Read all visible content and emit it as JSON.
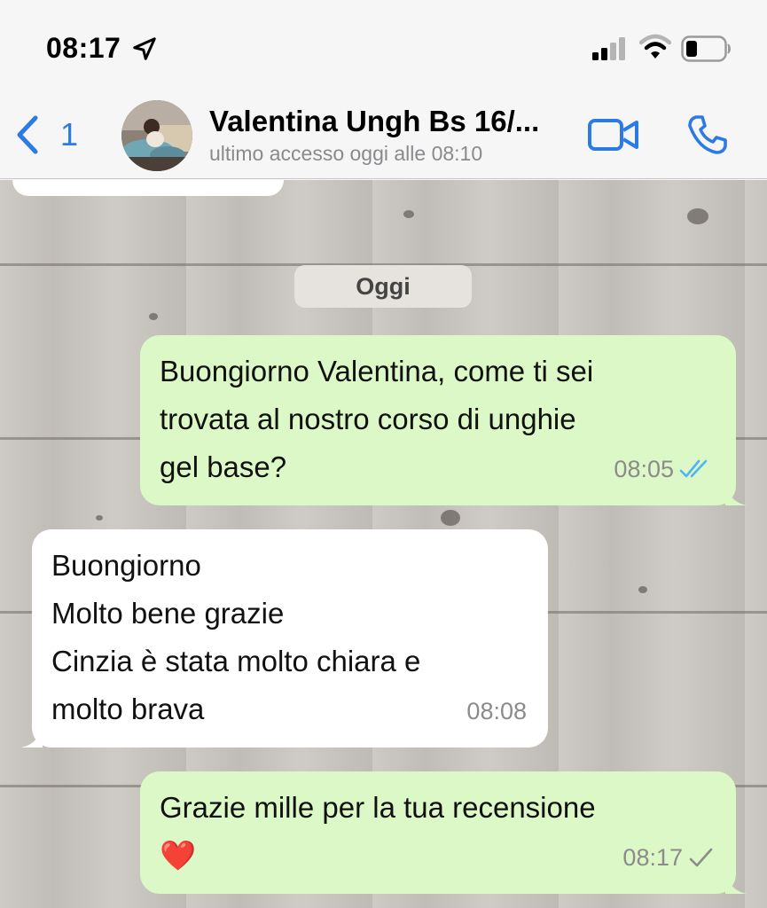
{
  "status_bar": {
    "time": "08:17"
  },
  "header": {
    "back_count": "1",
    "contact_name": "Valentina Ungh Bs 16/...",
    "contact_status": "ultimo accesso oggi alle 08:10"
  },
  "chat": {
    "date_label": "Oggi",
    "messages": [
      {
        "direction": "outgoing",
        "text": "Buongiorno Valentina, come ti sei\ntrovata al nostro corso di unghie\ngel base?",
        "time": "08:05",
        "status": "read"
      },
      {
        "direction": "incoming",
        "text": "Buongiorno\nMolto bene grazie\nCinzia è stata molto chiara e\nmolto brava",
        "time": "08:08"
      },
      {
        "direction": "outgoing",
        "text": "Grazie mille per la tua recensione\n❤️",
        "time": "08:17",
        "status": "delivered"
      }
    ]
  },
  "colors": {
    "accent": "#2c7be5",
    "outgoing_bubble": "#dcf8c6",
    "incoming_bubble": "#ffffff",
    "read_ticks": "#4fb3f6"
  },
  "icons": [
    "location-arrow-icon",
    "signal-icon",
    "wifi-icon",
    "battery-icon",
    "back-chevron-icon",
    "video-call-icon",
    "phone-icon",
    "double-check-icon",
    "single-check-icon"
  ]
}
